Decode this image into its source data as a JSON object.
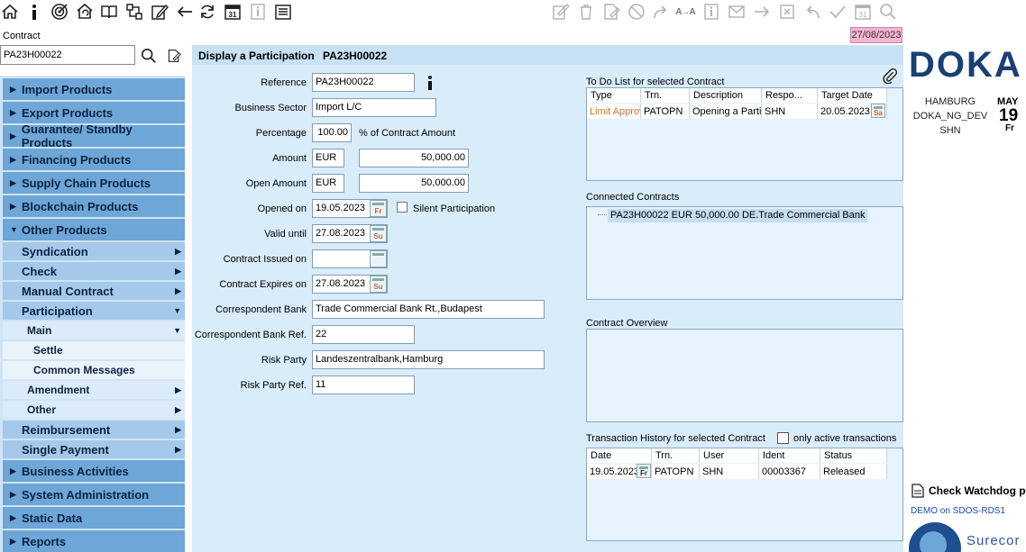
{
  "contract": {
    "label": "Contract",
    "value": "PA23H00022"
  },
  "date_badge": "27/08/2023",
  "sidebar": {
    "top": [
      "Import Products",
      "Export Products",
      "Guarantee/ Standby Products",
      "Financing Products",
      "Supply Chain Products",
      "Blockchain Products",
      "Other Products"
    ],
    "other_sub": [
      "Syndication",
      "Check",
      "Manual Contract",
      "Participation"
    ],
    "participation_sub": [
      "Main"
    ],
    "main_leaves": [
      "Settle",
      "Common Messages"
    ],
    "participation_more": [
      "Amendment",
      "Other"
    ],
    "other_more": [
      "Reimbursement",
      "Single Payment"
    ],
    "bottom": [
      "Business Activities",
      "System Administration",
      "Static Data",
      "Reports"
    ]
  },
  "form": {
    "title": "Display a Participation",
    "title_ref": "PA23H00022",
    "reference_label": "Reference",
    "reference": "PA23H00022",
    "sector_label": "Business Sector",
    "sector": "Import L/C",
    "percentage_label": "Percentage",
    "percentage": "100.00",
    "percentage_suffix": "% of Contract Amount",
    "amount_label": "Amount",
    "amount_cur": "EUR",
    "amount": "50,000.00",
    "open_amount_label": "Open Amount",
    "open_amount_cur": "EUR",
    "open_amount": "50,000.00",
    "opened_label": "Opened on",
    "opened": "19.05.2023",
    "opened_dow": "Fr",
    "silent_label": "Silent Participation",
    "valid_label": "Valid until",
    "valid": "27.08.2023",
    "valid_dow": "Su",
    "issued_label": "Contract Issued on",
    "issued": "",
    "expires_label": "Contract Expires on",
    "expires": "27.08.2023",
    "expires_dow": "Su",
    "corr_bank_label": "Correspondent Bank",
    "corr_bank": "Trade Commercial Bank Rt.,Budapest",
    "corr_ref_label": "Correspondent Bank Ref.",
    "corr_ref": "22",
    "risk_party_label": "Risk Party",
    "risk_party": "Landeszentralbank,Hamburg",
    "risk_ref_label": "Risk Party Ref.",
    "risk_ref": "11"
  },
  "todo": {
    "label": "To Do List for selected Contract",
    "headers": [
      "Type",
      "Trn.",
      "Description",
      "Respo...",
      "Target Date"
    ],
    "row": [
      "Limit Approv",
      "PATOPN",
      "Opening a Partic",
      "SHN",
      "20.05.2023"
    ],
    "row_dow": "Sa"
  },
  "connected": {
    "label": "Connected Contracts",
    "item": "PA23H00022 EUR 50,000.00 DE.Trade Commercial Bank"
  },
  "overview": {
    "label": "Contract Overview"
  },
  "history": {
    "label": "Transaction History for selected Contract",
    "only_active_label": "only active transactions",
    "headers": [
      "Date",
      "Trn.",
      "User",
      "Ident",
      "Status"
    ],
    "row": [
      "19.05.2023",
      "PATOPN",
      "SHN",
      "00003367",
      "Released"
    ],
    "row_dow": "Fr"
  },
  "right": {
    "logo": "DOKA",
    "location": "HAMBURG",
    "system": "DOKA_NG_DEV",
    "user": "SHN",
    "month": "MAY",
    "day": "19",
    "dow": "Fr",
    "watchdog": "Check Watchdog p",
    "server": "DEMO on SDOS-RDS1",
    "brand": "Surecor"
  },
  "colors": {
    "nav_top": "#6ea6d7",
    "nav_sub": "#a5c9ea",
    "main_bg": "#d9ecfa",
    "date_badge": "#f4b3d3",
    "brand": "#1b3f73"
  }
}
